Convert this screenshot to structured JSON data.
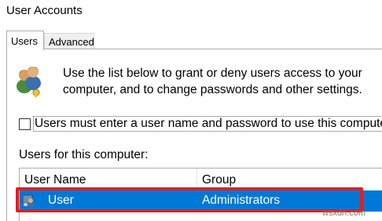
{
  "window": {
    "title": "User Accounts"
  },
  "tabs": [
    {
      "label": "Users",
      "selected": true
    },
    {
      "label": "Advanced",
      "selected": false
    }
  ],
  "users_tab": {
    "intro_text": "Use the list below to grant or deny users access to your computer, and to change passwords and other settings.",
    "require_login_checkbox": {
      "label": "Users must enter a user name and password to use this computer.",
      "checked": false
    },
    "users_list_label": "Users for this computer:",
    "list": {
      "columns": [
        "User Name",
        "Group"
      ],
      "rows": [
        {
          "name": "User",
          "group": "Administrators",
          "selected": true
        }
      ]
    }
  },
  "icons": {
    "users": "users-icon",
    "user_row": "user-account-icon"
  },
  "colors": {
    "selection": "#0078d7",
    "highlight_box": "#e0201f"
  },
  "watermark": "wsxdn.com"
}
